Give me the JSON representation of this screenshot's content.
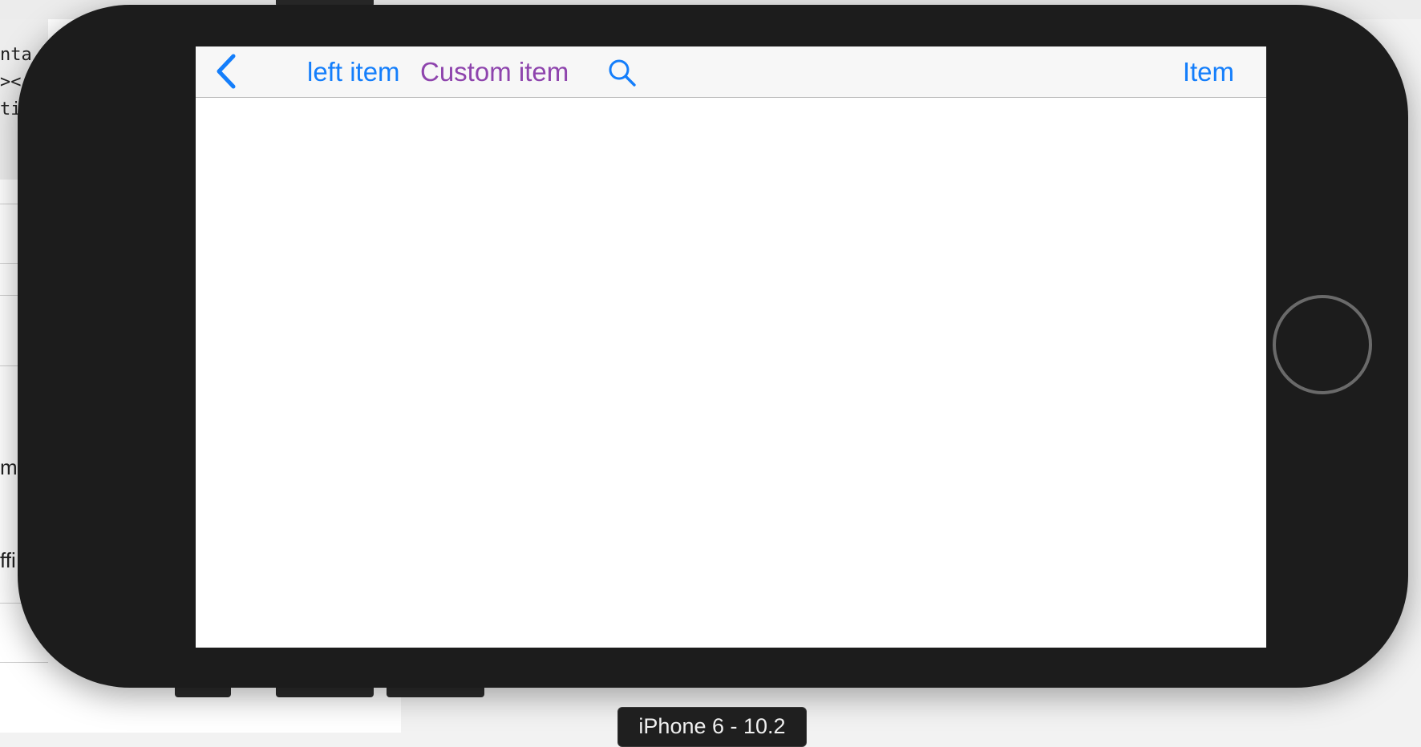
{
  "background": {
    "code_lines": [
      "nta",
      "><",
      "ti"
    ],
    "labels": [
      "m",
      "ffi"
    ]
  },
  "simulator": {
    "device_name": "iPhone 6 - 10.2"
  },
  "nav_bar": {
    "back_icon": "chevron-left-icon",
    "left_item_label": "left item",
    "custom_item_label": "Custom item",
    "search_icon": "search-icon",
    "right_item_label": "Item"
  },
  "colors": {
    "tint": "#147efb",
    "custom_item": "#8e44ad",
    "device_body": "#1c1c1c",
    "nav_bar_background": "#f7f7f7"
  }
}
